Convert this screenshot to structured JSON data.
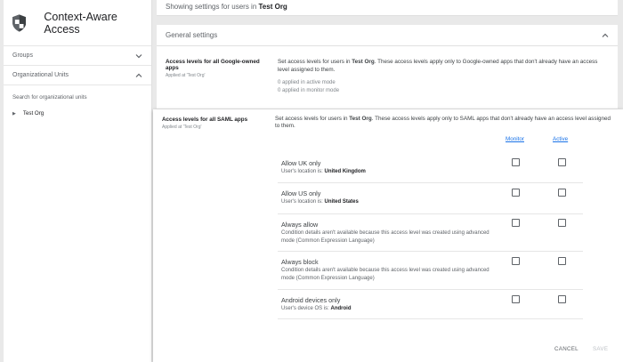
{
  "sidebar": {
    "title": "Context-Aware Access",
    "groups_label": "Groups",
    "org_units_label": "Organizational Units",
    "search_label": "Search for organizational units",
    "org_name": "Test Org"
  },
  "topbar": {
    "prefix": "Showing settings for users in",
    "org": "Test Org"
  },
  "general": {
    "label": "General settings"
  },
  "google_apps": {
    "title": "Access levels for all Google-owned apps",
    "applied_at": "Applied at 'Test Org'",
    "desc_prefix": "Set access levels for users in",
    "desc_org": "Test Org",
    "desc_suffix": ". These access levels apply only to Google-owned apps that don't already have an access level assigned to them.",
    "active_count": "0 applied in active mode",
    "monitor_count": "0 applied in monitor mode"
  },
  "saml_apps": {
    "title": "Access levels for all SAML apps",
    "applied_at": "Applied at 'Test Org'",
    "desc_prefix": "Set access levels for users in",
    "desc_org": "Test Org",
    "desc_suffix": ". These access levels apply only to SAML apps that don't already have an access level assigned to them.",
    "monitor_header": "Monitor",
    "active_header": "Active",
    "levels": [
      {
        "name": "Allow UK only",
        "detail_prefix": "User's location is:",
        "detail_value": "United Kingdom"
      },
      {
        "name": "Allow US only",
        "detail_prefix": "User's location is:",
        "detail_value": "United States"
      },
      {
        "name": "Always allow",
        "detail_text": "Condition details aren't available because this access level was created using advanced mode (Common Expression Language)"
      },
      {
        "name": "Always block",
        "detail_text": "Condition details aren't available because this access level was created using advanced mode (Common Expression Language)"
      },
      {
        "name": "Android devices only",
        "detail_prefix": "User's device OS is:",
        "detail_value": "Android"
      }
    ]
  },
  "footer": {
    "cancel_label": "CANCEL",
    "save_label": "SAVE"
  }
}
